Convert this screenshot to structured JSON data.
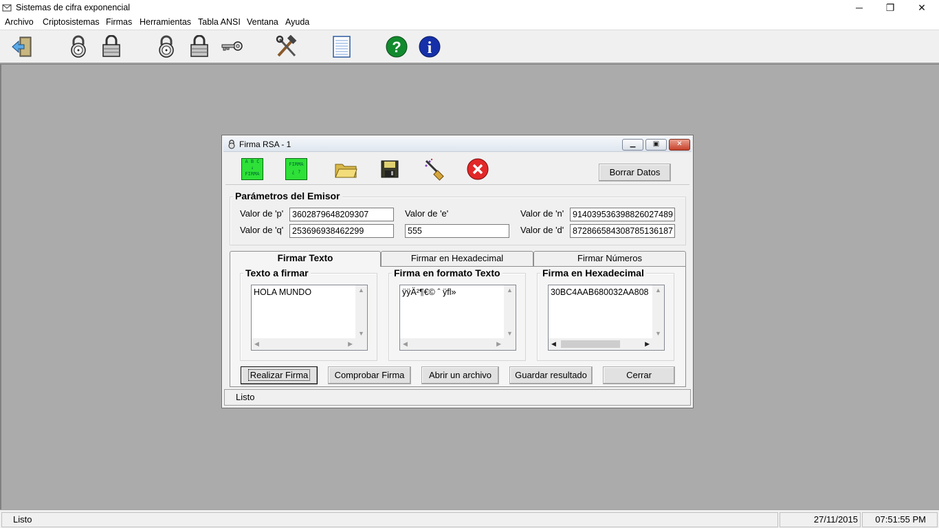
{
  "app": {
    "title": "Sistemas de cifra exponencial",
    "window_controls": {
      "minimize": "─",
      "restore": "❐",
      "close": "✕"
    }
  },
  "menu": [
    "Archivo",
    "Criptosistemas",
    "Firmas",
    "Herramientas",
    "Tabla ANSI",
    "Ventana",
    "Ayuda"
  ],
  "toolbar": {
    "icons": [
      "exit-icon",
      "lock-combination-icon",
      "padlock-icon",
      "lock-combination-icon",
      "padlock-icon",
      "key-icon",
      "tools-icon",
      "notepad-icon",
      "help-icon",
      "info-icon"
    ],
    "help_glyph": "?",
    "info_glyph": "i"
  },
  "child": {
    "title": "Firma RSA - 1",
    "controls": {
      "minimize": "▁",
      "restore": "▣",
      "close": "✕"
    },
    "toolbar_icons": [
      "abc-to-signature-icon",
      "verify-signature-icon",
      "open-folder-icon",
      "save-disk-icon",
      "clear-brush-icon",
      "close-red-icon"
    ],
    "abc_icon_text": "A B C\n↓\nFIRMA",
    "verify_icon_text": "FIRMA\n¿ ?",
    "clear_button": "Borrar Datos",
    "sender": {
      "legend": "Parámetros del Emisor",
      "p_label": "Valor de 'p'",
      "p_value": "3602879648209307",
      "q_label": "Valor de 'q'",
      "q_value": "253696938462299",
      "e_label": "Valor de 'e'",
      "e_value": "555",
      "n_label": "Valor de 'n'",
      "n_value": "914039536398826027489",
      "d_label": "Valor de 'd'",
      "d_value": "872866584308785136187"
    },
    "tabs": [
      "Firmar Texto",
      "Firmar en Hexadecimal",
      "Firmar Números"
    ],
    "active_tab": "Firmar Texto",
    "groups": {
      "text": {
        "legend": "Texto a firmar",
        "value": "HOLA MUNDO"
      },
      "sig_text": {
        "legend": "Firma en formato Texto",
        "value": "ÿÿÄ²¶€© ˆ ÿfl»"
      },
      "sig_hex": {
        "legend": "Firma en Hexadecimal",
        "value": "30BC4AAB680032AA808"
      }
    },
    "buttons": [
      "Realizar Firma",
      "Comprobar Firma",
      "Abrir un archivo",
      "Guardar resultado",
      "Cerrar"
    ],
    "status": "Listo"
  },
  "statusbar": {
    "message": "Listo",
    "date": "27/11/2015",
    "time": "07:51:55 PM"
  }
}
